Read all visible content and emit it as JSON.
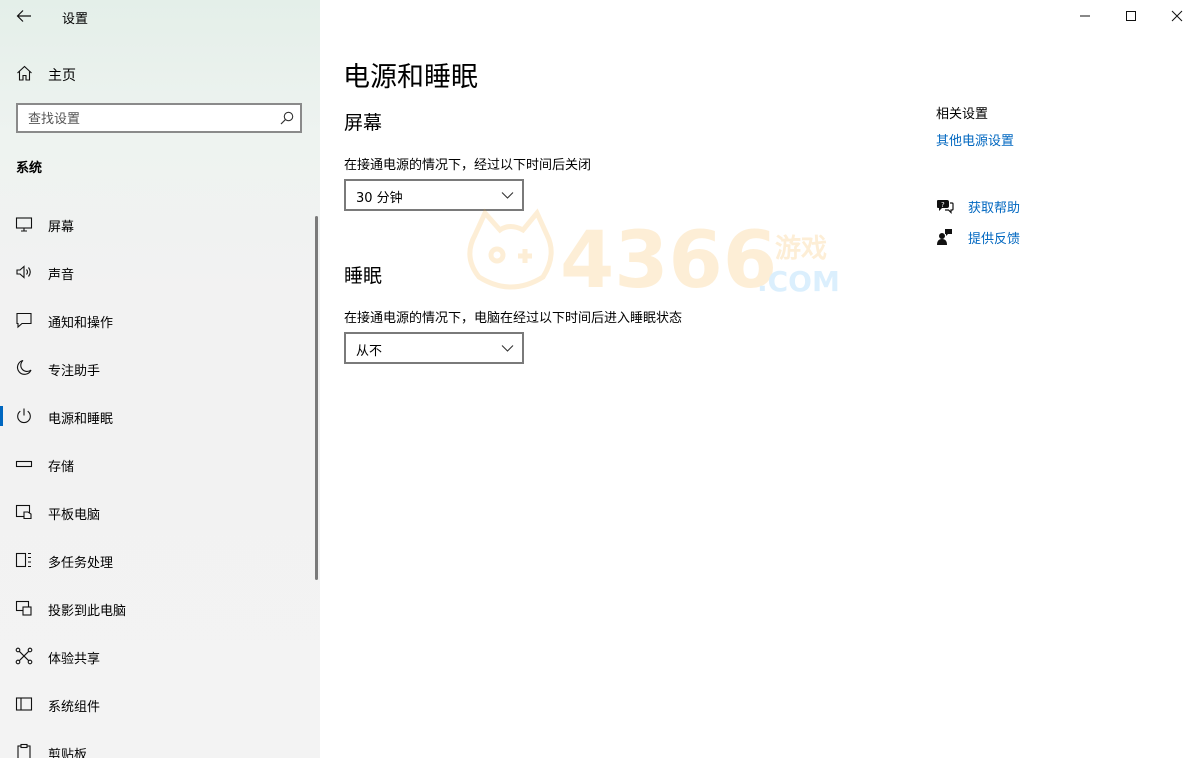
{
  "window": {
    "title": "设置",
    "controls": [
      "minimize-icon",
      "maximize-icon",
      "close-icon"
    ]
  },
  "sidebar": {
    "home_label": "主页",
    "search_placeholder": "查找设置",
    "section_title": "系统",
    "items": [
      {
        "label": "屏幕",
        "icon": "monitor-icon"
      },
      {
        "label": "声音",
        "icon": "speaker-icon"
      },
      {
        "label": "通知和操作",
        "icon": "notification-icon"
      },
      {
        "label": "专注助手",
        "icon": "moon-icon"
      },
      {
        "label": "电源和睡眠",
        "icon": "power-icon",
        "active": true
      },
      {
        "label": "存储",
        "icon": "storage-icon"
      },
      {
        "label": "平板电脑",
        "icon": "tablet-icon"
      },
      {
        "label": "多任务处理",
        "icon": "multitask-icon"
      },
      {
        "label": "投影到此电脑",
        "icon": "project-icon"
      },
      {
        "label": "体验共享",
        "icon": "share-icon"
      },
      {
        "label": "系统组件",
        "icon": "components-icon"
      },
      {
        "label": "剪贴板",
        "icon": "clipboard-icon"
      }
    ]
  },
  "main": {
    "title": "电源和睡眠",
    "screen": {
      "heading": "屏幕",
      "description": "在接通电源的情况下，经过以下时间后关闭",
      "value": "30 分钟"
    },
    "sleep": {
      "heading": "睡眠",
      "description": "在接通电源的情况下，电脑在经过以下时间后进入睡眠状态",
      "value": "从不"
    }
  },
  "related": {
    "title": "相关设置",
    "link": "其他电源设置",
    "help_label": "获取帮助",
    "feedback_label": "提供反馈"
  },
  "watermark": {
    "text": "4366",
    "suffix": "游戏",
    "domain": ".COM"
  },
  "colors": {
    "accent": "#0067c0",
    "watermark": "#f5a623"
  }
}
